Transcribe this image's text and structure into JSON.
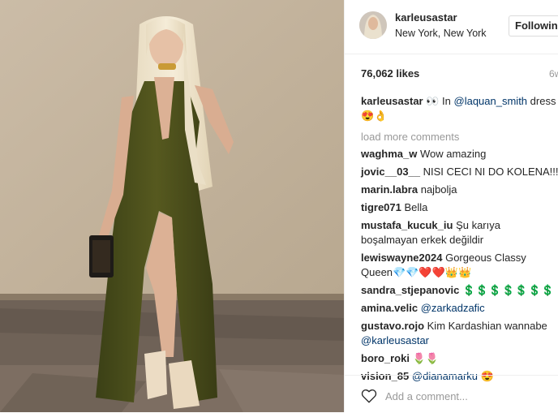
{
  "post": {
    "username": "karleusastar",
    "location": "New York, New York",
    "follow_label": "Following",
    "likes": "76,062 likes",
    "time_ago": "6w",
    "caption": {
      "user": "karleusastar",
      "text_before": "👀 In ",
      "mention": "@laquan_smith",
      "text_after": " dress 😍👌"
    },
    "load_more": "load more comments",
    "comments": [
      {
        "user": "waghma_w",
        "text": "Wow amazing"
      },
      {
        "user": "jovic__03__",
        "text": "NISI CECI NI DO KOLENA!!!"
      },
      {
        "user": "marin.labra",
        "text": "najbolja"
      },
      {
        "user": "tigre071",
        "text": "Bella"
      },
      {
        "user": "mustafa_kucuk_iu",
        "text": "Şu karıya boşalmayan erkek değildir"
      },
      {
        "user": "lewiswayne2024",
        "text": "Gorgeous Classy Queen💎💎❤️❤️👑👑"
      },
      {
        "user": "sandra_stjepanovic",
        "text": "💲💲💲💲💲💲💲"
      },
      {
        "user": "amina.velic",
        "mention": "@zarkadzafic"
      },
      {
        "user": "gustavo.rojo",
        "text": "Kim Kardashian wannabe",
        "mention": "@karleusastar"
      },
      {
        "user": "boro_roki",
        "text": "🌷🌷"
      },
      {
        "user": "vision_85",
        "mention": "@dianamarku",
        "text": " 😍"
      }
    ],
    "add_comment_placeholder": "Add a comment..."
  },
  "icons": {
    "like": "heart-outline-icon"
  },
  "colors": {
    "text": "#262626",
    "secondary": "#999999",
    "mention": "#003569",
    "border": "#efefef"
  }
}
